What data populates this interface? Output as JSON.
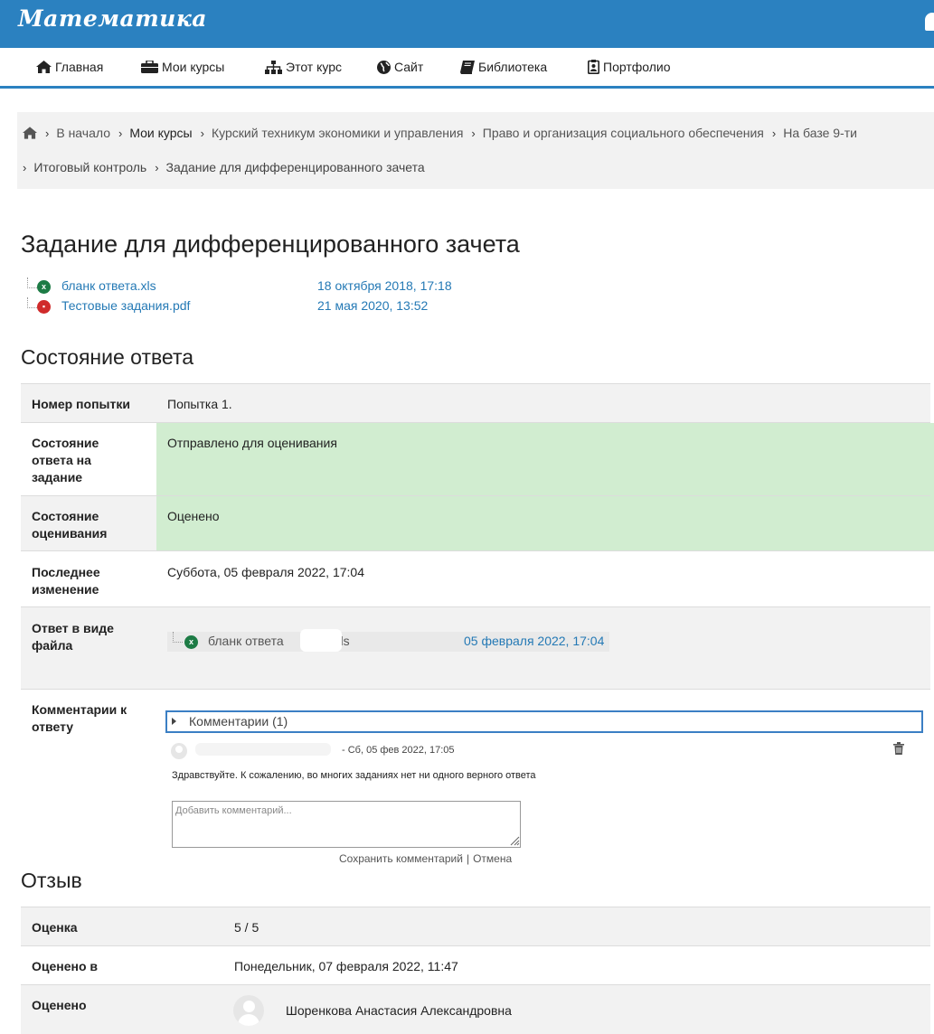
{
  "app": {
    "title": "Математика"
  },
  "nav": {
    "items": [
      {
        "label": "Главная",
        "icon": "home-icon"
      },
      {
        "label": "Мои курсы",
        "icon": "briefcase-icon"
      },
      {
        "label": "Этот курс",
        "icon": "sitemap-icon"
      },
      {
        "label": "Сайт",
        "icon": "globe-icon"
      },
      {
        "label": "Библиотека",
        "icon": "book-icon"
      },
      {
        "label": "Портфолио",
        "icon": "portfolio-icon"
      }
    ]
  },
  "breadcrumb": {
    "items": [
      "В начало",
      "Мои курсы",
      "Курский техникум экономики и управления",
      "Право и организация социального обеспечения",
      "На базе 9-ти",
      "Итоговый контроль",
      "Задание для дифференцированного зачета"
    ]
  },
  "page": {
    "title": "Задание для дифференцированного зачета"
  },
  "files": [
    {
      "name": "бланк ответа.xls",
      "date": "18 октября 2018, 17:18",
      "type": "xls"
    },
    {
      "name": "Тестовые задания.pdf",
      "date": "21 мая 2020, 13:52",
      "type": "pdf"
    }
  ],
  "submission": {
    "heading": "Состояние ответа",
    "attempt_label": "Номер попытки",
    "attempt_value": "Попытка 1.",
    "status_label": "Состояние ответа на задание",
    "status_value": "Отправлено для оценивания",
    "grading_label": "Состояние оценивания",
    "grading_value": "Оценено",
    "modified_label": "Последнее изменение",
    "modified_value": "Суббота, 05 февраля 2022, 17:04",
    "file_label": "Ответ в виде файла",
    "file_name_prefix": "бланк ответа",
    "file_name_suffix": ".xls",
    "file_date": "05 февраля 2022, 17:04",
    "comments_label": "Комментарии к ответу"
  },
  "comments": {
    "toggle": "Комментарии (1)",
    "meta": "- Сб, 05 фев 2022, 17:05",
    "text": "Здравствуйте. К сожалению, во многих заданиях нет ни одного верного ответа",
    "placeholder": "Добавить комментарий...",
    "save": "Сохранить комментарий",
    "cancel": "Отмена"
  },
  "feedback": {
    "heading": "Отзыв",
    "grade_label": "Оценка",
    "grade_value": "5 / 5",
    "graded_on_label": "Оценено в",
    "graded_on_value": "Понедельник, 07 февраля 2022, 11:47",
    "graded_by_label": "Оценено",
    "graded_by_value": "Шоренкова Анастасия Александровна"
  },
  "colors": {
    "brand": "#2b81c0",
    "link": "#2479b5",
    "success_bg": "#d1edd0",
    "row_gray": "#f2f2f2"
  }
}
